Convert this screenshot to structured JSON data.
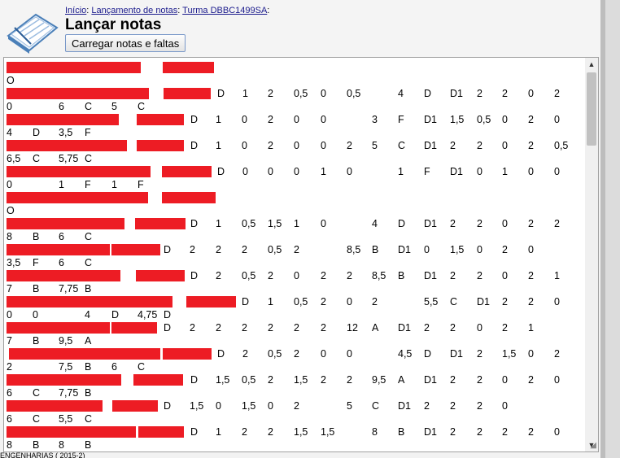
{
  "breadcrumb": {
    "home": "Início",
    "launch": "Lançamento de notas",
    "class": "Turma DBBC1499SA",
    "sep": ":"
  },
  "page_title": "Lançar notas",
  "load_button": "Carregar notas e faltas",
  "footer_text": "ENGENHARIAS ( 2015-2)",
  "rows": [
    {
      "redact": [
        [
          3,
          168
        ],
        [
          195,
          258
        ]
      ],
      "tokens": []
    },
    {
      "redact": [],
      "tokens": [
        [
          3,
          "O"
        ]
      ]
    },
    {
      "redact": [
        [
          3,
          178
        ],
        [
          196,
          254
        ]
      ],
      "tokens": [
        [
          262,
          "D"
        ],
        [
          293,
          "1"
        ],
        [
          324,
          "2"
        ],
        [
          356,
          "0,5"
        ],
        [
          389,
          "0"
        ],
        [
          421,
          "0,5"
        ],
        [
          484,
          "4"
        ],
        [
          516,
          "D"
        ],
        [
          548,
          "D1"
        ],
        [
          581,
          "2"
        ],
        [
          612,
          "2"
        ],
        [
          644,
          "0"
        ],
        [
          676,
          "2"
        ]
      ]
    },
    {
      "redact": [],
      "tokens": [
        [
          3,
          "0"
        ],
        [
          67,
          "6"
        ],
        [
          99,
          "C"
        ],
        [
          132,
          "5"
        ],
        [
          164,
          "C"
        ]
      ]
    },
    {
      "redact": [
        [
          3,
          141
        ],
        [
          163,
          221
        ]
      ],
      "tokens": [
        [
          229,
          "D"
        ],
        [
          260,
          "1"
        ],
        [
          292,
          "0"
        ],
        [
          324,
          "2"
        ],
        [
          356,
          "0"
        ],
        [
          389,
          "0"
        ],
        [
          452,
          "3"
        ],
        [
          484,
          "F"
        ],
        [
          516,
          "D1"
        ],
        [
          548,
          "1,5"
        ],
        [
          581,
          "0,5"
        ],
        [
          612,
          "0"
        ],
        [
          644,
          "2"
        ],
        [
          676,
          "0"
        ]
      ]
    },
    {
      "redact": [],
      "tokens": [
        [
          3,
          "4"
        ],
        [
          35,
          "D"
        ],
        [
          67,
          "3,5"
        ],
        [
          99,
          "F"
        ]
      ]
    },
    {
      "redact": [
        [
          3,
          151
        ],
        [
          163,
          221
        ]
      ],
      "tokens": [
        [
          229,
          "D"
        ],
        [
          260,
          "1"
        ],
        [
          292,
          "0"
        ],
        [
          324,
          "2"
        ],
        [
          356,
          "0"
        ],
        [
          389,
          "0"
        ],
        [
          421,
          "2"
        ],
        [
          452,
          "5"
        ],
        [
          484,
          "C"
        ],
        [
          516,
          "D1"
        ],
        [
          548,
          "2"
        ],
        [
          581,
          "2"
        ],
        [
          612,
          "0"
        ],
        [
          644,
          "2"
        ],
        [
          676,
          "0,5"
        ]
      ]
    },
    {
      "redact": [],
      "tokens": [
        [
          3,
          "6,5"
        ],
        [
          35,
          "C"
        ],
        [
          67,
          "5,75"
        ],
        [
          99,
          "C"
        ]
      ]
    },
    {
      "redact": [
        [
          3,
          180
        ],
        [
          194,
          255
        ]
      ],
      "tokens": [
        [
          262,
          "D"
        ],
        [
          293,
          "0"
        ],
        [
          324,
          "0"
        ],
        [
          356,
          "0"
        ],
        [
          389,
          "1"
        ],
        [
          421,
          "0"
        ],
        [
          484,
          "1"
        ],
        [
          516,
          "F"
        ],
        [
          548,
          "D1"
        ],
        [
          581,
          "0"
        ],
        [
          612,
          "1"
        ],
        [
          644,
          "0"
        ],
        [
          676,
          "0"
        ]
      ]
    },
    {
      "redact": [],
      "tokens": [
        [
          3,
          "0"
        ],
        [
          67,
          "1"
        ],
        [
          99,
          "F"
        ],
        [
          132,
          "1"
        ],
        [
          164,
          "F"
        ]
      ]
    },
    {
      "redact": [
        [
          3,
          177
        ],
        [
          194,
          260
        ]
      ],
      "tokens": []
    },
    {
      "redact": [],
      "tokens": [
        [
          3,
          "O"
        ]
      ]
    },
    {
      "redact": [
        [
          3,
          148
        ],
        [
          161,
          223
        ]
      ],
      "tokens": [
        [
          229,
          "D"
        ],
        [
          260,
          "1"
        ],
        [
          292,
          "0,5"
        ],
        [
          324,
          "1,5"
        ],
        [
          356,
          "1"
        ],
        [
          389,
          "0"
        ],
        [
          452,
          "4"
        ],
        [
          484,
          "D"
        ],
        [
          516,
          "D1"
        ],
        [
          548,
          "2"
        ],
        [
          581,
          "2"
        ],
        [
          612,
          "0"
        ],
        [
          644,
          "2"
        ],
        [
          676,
          "2"
        ]
      ]
    },
    {
      "redact": [],
      "tokens": [
        [
          3,
          "8"
        ],
        [
          35,
          "B"
        ],
        [
          67,
          "6"
        ],
        [
          99,
          "C"
        ]
      ]
    },
    {
      "redact": [
        [
          3,
          130
        ],
        [
          132,
          192
        ]
      ],
      "tokens": [
        [
          196,
          "D"
        ],
        [
          228,
          "2"
        ],
        [
          260,
          "2"
        ],
        [
          292,
          "2"
        ],
        [
          324,
          "0,5"
        ],
        [
          356,
          "2"
        ],
        [
          421,
          "8,5"
        ],
        [
          452,
          "B"
        ],
        [
          484,
          "D1"
        ],
        [
          516,
          "0"
        ],
        [
          548,
          "1,5"
        ],
        [
          581,
          "0"
        ],
        [
          612,
          "2"
        ],
        [
          644,
          "0"
        ]
      ]
    },
    {
      "redact": [],
      "tokens": [
        [
          3,
          "3,5"
        ],
        [
          35,
          "F"
        ],
        [
          67,
          "6"
        ],
        [
          99,
          "C"
        ]
      ]
    },
    {
      "redact": [
        [
          3,
          143
        ],
        [
          162,
          222
        ]
      ],
      "tokens": [
        [
          229,
          "D"
        ],
        [
          260,
          "2"
        ],
        [
          292,
          "0,5"
        ],
        [
          324,
          "2"
        ],
        [
          356,
          "0"
        ],
        [
          389,
          "2"
        ],
        [
          421,
          "2"
        ],
        [
          452,
          "8,5"
        ],
        [
          484,
          "B"
        ],
        [
          516,
          "D1"
        ],
        [
          548,
          "2"
        ],
        [
          581,
          "2"
        ],
        [
          612,
          "0"
        ],
        [
          644,
          "2"
        ],
        [
          676,
          "1"
        ]
      ]
    },
    {
      "redact": [],
      "tokens": [
        [
          3,
          "7"
        ],
        [
          35,
          "B"
        ],
        [
          67,
          "7,75"
        ],
        [
          99,
          "B"
        ]
      ]
    },
    {
      "redact": [
        [
          3,
          207
        ],
        [
          224,
          285
        ]
      ],
      "tokens": [
        [
          292,
          "D"
        ],
        [
          324,
          "1"
        ],
        [
          356,
          "0,5"
        ],
        [
          389,
          "2"
        ],
        [
          421,
          "0"
        ],
        [
          452,
          "2"
        ],
        [
          516,
          "5,5"
        ],
        [
          548,
          "C"
        ],
        [
          581,
          "D1"
        ],
        [
          612,
          "2"
        ],
        [
          644,
          "2"
        ],
        [
          676,
          "0"
        ]
      ]
    },
    {
      "redact": [],
      "tokens": [
        [
          3,
          "0"
        ],
        [
          35,
          "0"
        ],
        [
          99,
          "4"
        ],
        [
          132,
          "D"
        ],
        [
          164,
          "4,75"
        ],
        [
          196,
          "D"
        ]
      ]
    },
    {
      "redact": [
        [
          3,
          130
        ],
        [
          132,
          188
        ]
      ],
      "tokens": [
        [
          196,
          "D"
        ],
        [
          228,
          "2"
        ],
        [
          260,
          "2"
        ],
        [
          292,
          "2"
        ],
        [
          324,
          "2"
        ],
        [
          356,
          "2"
        ],
        [
          389,
          "2"
        ],
        [
          421,
          "12"
        ],
        [
          452,
          "A"
        ],
        [
          484,
          "D1"
        ],
        [
          516,
          "2"
        ],
        [
          548,
          "2"
        ],
        [
          581,
          "0"
        ],
        [
          612,
          "2"
        ],
        [
          644,
          "1"
        ]
      ]
    },
    {
      "redact": [],
      "tokens": [
        [
          3,
          "7"
        ],
        [
          35,
          "B"
        ],
        [
          67,
          "9,5"
        ],
        [
          99,
          "A"
        ]
      ]
    },
    {
      "redact": [
        [
          6,
          192
        ],
        [
          195,
          255
        ]
      ],
      "tokens": [
        [
          262,
          "D"
        ],
        [
          293,
          "2"
        ],
        [
          324,
          "0,5"
        ],
        [
          356,
          "2"
        ],
        [
          389,
          "0"
        ],
        [
          421,
          "0"
        ],
        [
          484,
          "4,5"
        ],
        [
          516,
          "D"
        ],
        [
          548,
          "D1"
        ],
        [
          581,
          "2"
        ],
        [
          612,
          "1,5"
        ],
        [
          644,
          "0"
        ],
        [
          676,
          "2"
        ]
      ]
    },
    {
      "redact": [],
      "tokens": [
        [
          3,
          "2"
        ],
        [
          67,
          "7,5"
        ],
        [
          99,
          "B"
        ],
        [
          132,
          "6"
        ],
        [
          164,
          "C"
        ]
      ]
    },
    {
      "redact": [
        [
          3,
          144
        ],
        [
          159,
          220
        ]
      ],
      "tokens": [
        [
          229,
          "D"
        ],
        [
          260,
          "1,5"
        ],
        [
          292,
          "0,5"
        ],
        [
          324,
          "2"
        ],
        [
          356,
          "1,5"
        ],
        [
          389,
          "2"
        ],
        [
          421,
          "2"
        ],
        [
          452,
          "9,5"
        ],
        [
          484,
          "A"
        ],
        [
          516,
          "D1"
        ],
        [
          548,
          "2"
        ],
        [
          581,
          "2"
        ],
        [
          612,
          "0"
        ],
        [
          644,
          "2"
        ],
        [
          676,
          "0"
        ]
      ]
    },
    {
      "redact": [],
      "tokens": [
        [
          3,
          "6"
        ],
        [
          35,
          "C"
        ],
        [
          67,
          "7,75"
        ],
        [
          99,
          "B"
        ]
      ]
    },
    {
      "redact": [
        [
          3,
          121
        ],
        [
          133,
          189
        ]
      ],
      "tokens": [
        [
          196,
          "D"
        ],
        [
          228,
          "1,5"
        ],
        [
          260,
          "0"
        ],
        [
          292,
          "1,5"
        ],
        [
          324,
          "0"
        ],
        [
          356,
          "2"
        ],
        [
          421,
          "5"
        ],
        [
          452,
          "C"
        ],
        [
          484,
          "D1"
        ],
        [
          516,
          "2"
        ],
        [
          548,
          "2"
        ],
        [
          581,
          "2"
        ],
        [
          612,
          "0"
        ]
      ]
    },
    {
      "redact": [],
      "tokens": [
        [
          3,
          "6"
        ],
        [
          35,
          "C"
        ],
        [
          67,
          "5,5"
        ],
        [
          99,
          "C"
        ]
      ]
    },
    {
      "redact": [
        [
          3,
          162
        ],
        [
          165,
          221
        ]
      ],
      "tokens": [
        [
          229,
          "D"
        ],
        [
          260,
          "1"
        ],
        [
          292,
          "2"
        ],
        [
          324,
          "2"
        ],
        [
          356,
          "1,5"
        ],
        [
          389,
          "1,5"
        ],
        [
          452,
          "8"
        ],
        [
          484,
          "B"
        ],
        [
          516,
          "D1"
        ],
        [
          548,
          "2"
        ],
        [
          581,
          "2"
        ],
        [
          612,
          "2"
        ],
        [
          644,
          "2"
        ],
        [
          676,
          "0"
        ]
      ]
    },
    {
      "redact": [],
      "tokens": [
        [
          3,
          "8"
        ],
        [
          35,
          "B"
        ],
        [
          67,
          "8"
        ],
        [
          99,
          "B"
        ]
      ]
    }
  ]
}
